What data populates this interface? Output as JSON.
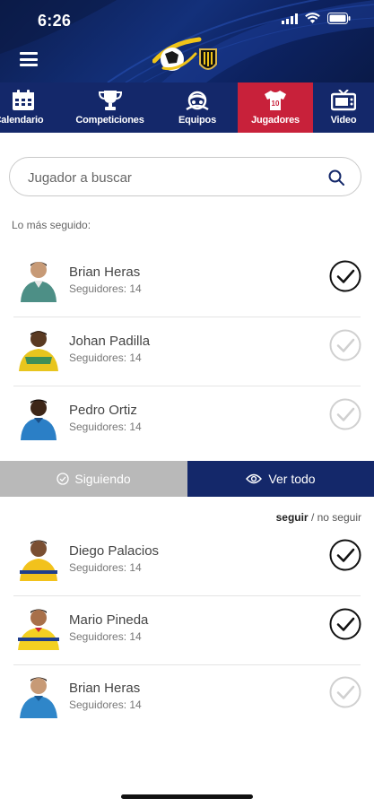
{
  "status_bar": {
    "time": "6:26"
  },
  "tabs": [
    {
      "label": "Calendario",
      "icon": "calendar-icon",
      "active": false
    },
    {
      "label": "Competiciones",
      "icon": "trophy-icon",
      "active": false
    },
    {
      "label": "Equipos",
      "icon": "team-icon",
      "active": false
    },
    {
      "label": "Jugadores",
      "icon": "jersey-icon",
      "active": true
    },
    {
      "label": "Video",
      "icon": "tv-icon",
      "active": false
    }
  ],
  "search": {
    "placeholder": "Jugador a buscar"
  },
  "top_followed": {
    "label": "Lo más seguido:",
    "players": [
      {
        "name": "Brian Heras",
        "followers": "Seguidores: 14",
        "following": true
      },
      {
        "name": "Johan Padilla",
        "followers": "Seguidores: 14",
        "following": false
      },
      {
        "name": "Pedro Ortiz",
        "followers": "Seguidores: 14",
        "following": false
      }
    ]
  },
  "toggle": {
    "following_label": "Siguiendo",
    "all_label": "Ver todo"
  },
  "follow_filter": {
    "on": "seguir",
    "separator": " / ",
    "off": "no seguir"
  },
  "following_list": [
    {
      "name": "Diego Palacios",
      "followers": "Seguidores: 14",
      "following": true
    },
    {
      "name": "Mario Pineda",
      "followers": "Seguidores: 14",
      "following": true
    },
    {
      "name": "Brian Heras",
      "followers": "Seguidores: 14",
      "following": false
    }
  ],
  "colors": {
    "navy": "#14286a",
    "active_tab": "#c8213a",
    "toggle_inactive": "#b9b9b9"
  }
}
